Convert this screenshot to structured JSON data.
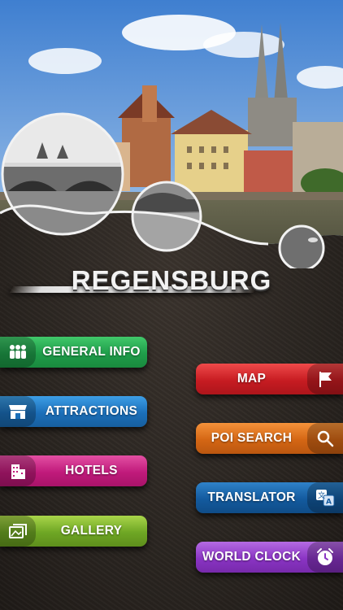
{
  "app": {
    "title": "REGENSBURG"
  },
  "menu": {
    "left": [
      {
        "label": "GENERAL INFO",
        "icon": "people-icon",
        "color": "#1f9d4a"
      },
      {
        "label": "ATTRACTIONS",
        "icon": "store-icon",
        "color": "#1b6fb9"
      },
      {
        "label": "HOTELS",
        "icon": "building-icon",
        "color": "#c01a7b"
      },
      {
        "label": "GALLERY",
        "icon": "photos-icon",
        "color": "#6ea624"
      }
    ],
    "right": [
      {
        "label": "MAP",
        "icon": "flag-icon",
        "color": "#c71c22"
      },
      {
        "label": "POI SEARCH",
        "icon": "search-icon",
        "color": "#d46614"
      },
      {
        "label": "TRANSLATOR",
        "icon": "translate-icon",
        "color": "#135a9e"
      },
      {
        "label": "WORLD CLOCK",
        "icon": "alarm-clock-icon",
        "color": "#8a34c4"
      }
    ]
  }
}
